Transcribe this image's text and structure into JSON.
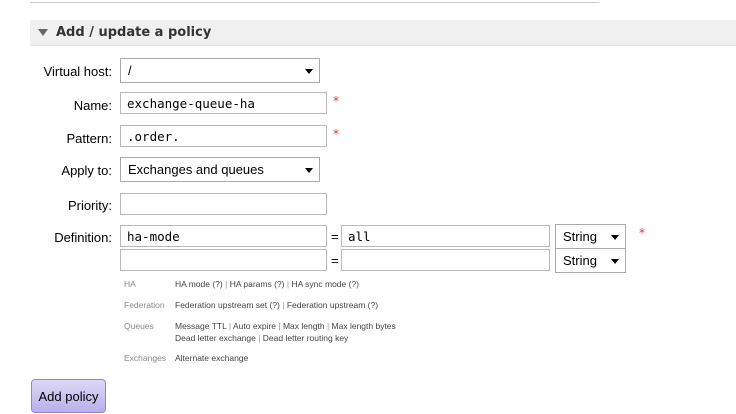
{
  "section": {
    "title": "Add / update a policy"
  },
  "form": {
    "vhost": {
      "label": "Virtual host:",
      "value": "/"
    },
    "name": {
      "label": "Name:",
      "value": "exchange-queue-ha",
      "required": "*"
    },
    "pattern": {
      "label": "Pattern:",
      "value": ".order.",
      "required": "*"
    },
    "apply_to": {
      "label": "Apply to:",
      "value": "Exchanges and queues"
    },
    "priority": {
      "label": "Priority:",
      "value": ""
    },
    "definition": {
      "label": "Definition:",
      "required": "*",
      "rows": [
        {
          "key": "ha-mode",
          "eq": "=",
          "value": "all",
          "type": "String"
        },
        {
          "key": "",
          "eq": "=",
          "value": "",
          "type": "String"
        }
      ]
    }
  },
  "help": {
    "ha": {
      "category": "HA",
      "lines": [
        [
          "HA mode (?)",
          "HA params (?)",
          "HA sync mode (?)"
        ]
      ]
    },
    "federation": {
      "category": "Federation",
      "lines": [
        [
          "Federation upstream set (?)",
          "Federation upstream (?)"
        ]
      ]
    },
    "queues": {
      "category": "Queues",
      "lines": [
        [
          "Message TTL",
          "Auto expire",
          "Max length",
          "Max length bytes"
        ],
        [
          "Dead letter exchange",
          "Dead letter routing key"
        ]
      ]
    },
    "exchanges": {
      "category": "Exchanges",
      "lines": [
        [
          "Alternate exchange"
        ]
      ]
    }
  },
  "separator": "|",
  "buttons": {
    "add_policy": "Add policy"
  },
  "colors": {
    "button_bg": "#c8c2f0",
    "required": "#e03030"
  }
}
